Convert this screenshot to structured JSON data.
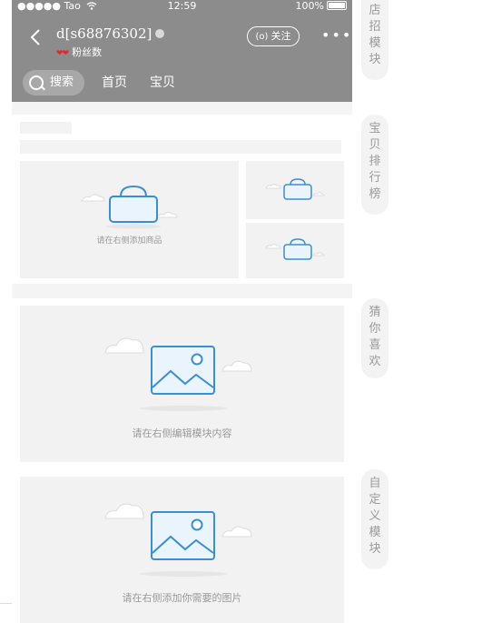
{
  "status_bar": {
    "carrier": "●●●●● Tao",
    "wifi_icon": "wifi-icon",
    "time": "12:59",
    "battery": "100%"
  },
  "header": {
    "shop_name": "d[s68876302]",
    "fans_label": "粉丝数",
    "hearts": "❤❤",
    "follow_label": "关注",
    "follow_icon": "(o)",
    "more": "•••",
    "search_label": "搜索",
    "tabs": [
      "首页",
      "宝贝"
    ]
  },
  "modules": {
    "ranking_hint": "请在右侧添加商品",
    "guess_hint": "请在右侧编辑模块内容",
    "custom_hint": "请在右侧添加你需要的图片"
  },
  "side_tags": {
    "shop_sign": [
      "店",
      "招",
      "模",
      "块"
    ],
    "ranking": [
      "宝",
      "贝",
      "排",
      "行",
      "榜"
    ],
    "guess": [
      "猜",
      "你",
      "喜",
      "欢"
    ],
    "custom": [
      "自",
      "定",
      "义",
      "模",
      "块"
    ]
  },
  "colors": {
    "header_bg": "#8c8c8c",
    "icon_blue": "#3a8ed6",
    "placeholder_bg": "#f2f2f2"
  }
}
